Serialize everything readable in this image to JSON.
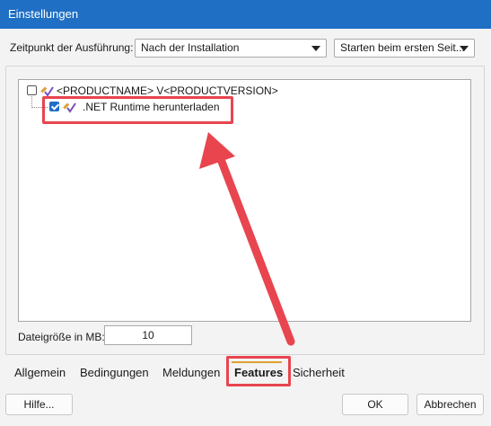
{
  "window": {
    "title": "Einstellungen"
  },
  "execution": {
    "label": "Zeitpunkt der Ausführung:",
    "time_value": "Nach der Installation",
    "start_value": "Starten beim ersten Seit..."
  },
  "tree": {
    "root": {
      "label": "<PRODUCTNAME> V<PRODUCTVERSION>",
      "checked": false
    },
    "child": {
      "label": ".NET Runtime herunterladen",
      "checked": true
    }
  },
  "filesize": {
    "label": "Dateigröße in MB:",
    "value": "10"
  },
  "tabs": [
    {
      "label": "Allgemein"
    },
    {
      "label": "Bedingungen"
    },
    {
      "label": "Meldungen"
    },
    {
      "label": "Features"
    },
    {
      "label": "Sicherheit"
    }
  ],
  "active_tab": "Features",
  "buttons": {
    "help": "Hilfe...",
    "ok": "OK",
    "cancel": "Abbrechen"
  },
  "colors": {
    "titlebar": "#1f6fc4",
    "highlight": "#e8454f",
    "tab_underline": "#e0a030"
  }
}
